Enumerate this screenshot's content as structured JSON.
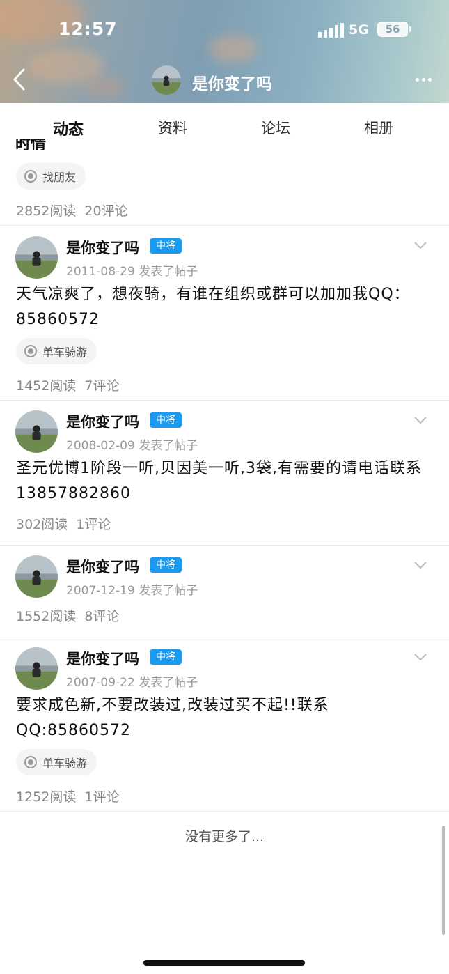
{
  "status": {
    "time": "12:57",
    "network": "5G",
    "battery": "56"
  },
  "header": {
    "title": "是你变了吗"
  },
  "tabs": [
    {
      "label": "动态",
      "active": true
    },
    {
      "label": "资料",
      "active": false
    },
    {
      "label": "论坛",
      "active": false
    },
    {
      "label": "相册",
      "active": false
    }
  ],
  "first_post": {
    "cut_text": "时情",
    "tag": "找朋友",
    "reads": "2852阅读",
    "comments": "20评论"
  },
  "posts": [
    {
      "author": "是你变了吗",
      "badge": "中将",
      "date": "2011-08-29 发表了帖子",
      "body": "天气凉爽了，想夜骑，有谁在组织或群可以加加我QQ：85860572",
      "tag": "单车骑游",
      "reads": "1452阅读",
      "comments": "7评论"
    },
    {
      "author": "是你变了吗",
      "badge": "中将",
      "date": "2008-02-09 发表了帖子",
      "body": "圣元优博1阶段一听,贝因美一听,3袋,有需要的请电话联系13857882860",
      "tag": "",
      "reads": "302阅读",
      "comments": "1评论"
    },
    {
      "author": "是你变了吗",
      "badge": "中将",
      "date": "2007-12-19 发表了帖子",
      "body": "",
      "tag": "",
      "reads": "1552阅读",
      "comments": "8评论"
    },
    {
      "author": "是你变了吗",
      "badge": "中将",
      "date": "2007-09-22 发表了帖子",
      "body": "要求成色新,不要改装过,改装过买不起!!联系QQ:85860572",
      "tag": "单车骑游",
      "reads": "1252阅读",
      "comments": "1评论"
    }
  ],
  "footer": {
    "no_more": "没有更多了..."
  },
  "colors": {
    "badge": "#1a9bf0",
    "text": "#111111",
    "meta": "#999999"
  }
}
